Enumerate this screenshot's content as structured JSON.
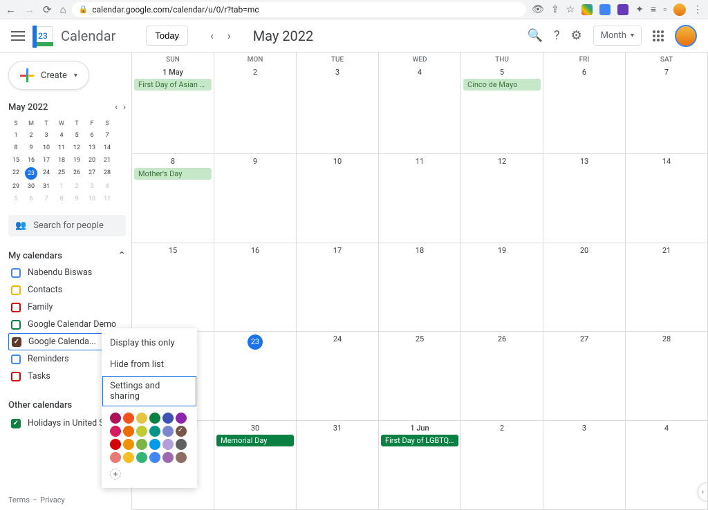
{
  "browser": {
    "url": "calendar.google.com/calendar/u/0/r?tab=mc"
  },
  "header": {
    "app_name": "Calendar",
    "logo_day": "23",
    "today_label": "Today",
    "current_period": "May 2022",
    "view_label": "Month"
  },
  "create": {
    "label": "Create"
  },
  "mini": {
    "month": "May 2022",
    "dow": [
      "S",
      "M",
      "T",
      "W",
      "T",
      "F",
      "S"
    ],
    "weeks": [
      [
        {
          "n": "1"
        },
        {
          "n": "2"
        },
        {
          "n": "3"
        },
        {
          "n": "4"
        },
        {
          "n": "5"
        },
        {
          "n": "6"
        },
        {
          "n": "7"
        }
      ],
      [
        {
          "n": "8"
        },
        {
          "n": "9"
        },
        {
          "n": "10"
        },
        {
          "n": "11"
        },
        {
          "n": "12"
        },
        {
          "n": "13"
        },
        {
          "n": "14"
        }
      ],
      [
        {
          "n": "15"
        },
        {
          "n": "16"
        },
        {
          "n": "17"
        },
        {
          "n": "18"
        },
        {
          "n": "19"
        },
        {
          "n": "20"
        },
        {
          "n": "21"
        }
      ],
      [
        {
          "n": "22"
        },
        {
          "n": "23",
          "today": true
        },
        {
          "n": "24"
        },
        {
          "n": "25"
        },
        {
          "n": "26"
        },
        {
          "n": "27"
        },
        {
          "n": "28"
        }
      ],
      [
        {
          "n": "29"
        },
        {
          "n": "30"
        },
        {
          "n": "31"
        },
        {
          "n": "1",
          "other": true
        },
        {
          "n": "2",
          "other": true
        },
        {
          "n": "3",
          "other": true
        },
        {
          "n": "4",
          "other": true
        }
      ],
      [
        {
          "n": "5",
          "other": true
        },
        {
          "n": "6",
          "other": true
        },
        {
          "n": "7",
          "other": true
        },
        {
          "n": "8",
          "other": true
        },
        {
          "n": "9",
          "other": true
        },
        {
          "n": "10",
          "other": true
        },
        {
          "n": "11",
          "other": true
        }
      ]
    ]
  },
  "search": {
    "placeholder": "Search for people"
  },
  "my_calendars": {
    "title": "My calendars",
    "items": [
      {
        "label": "Nabendu Biswas",
        "color": "#4285f4",
        "checked": false
      },
      {
        "label": "Contacts",
        "color": "#f4b400",
        "checked": false
      },
      {
        "label": "Family",
        "color": "#d50000",
        "checked": false
      },
      {
        "label": "Google Calendar Demo",
        "color": "#0b8043",
        "checked": false
      },
      {
        "label": "Google Calenda...",
        "color": "#5f3a29",
        "checked": true,
        "focused": true,
        "close": true
      },
      {
        "label": "Reminders",
        "color": "#4285f4",
        "checked": false
      },
      {
        "label": "Tasks",
        "color": "#d50000",
        "checked": false
      }
    ]
  },
  "other_calendars": {
    "title": "Other calendars",
    "items": [
      {
        "label": "Holidays in United States",
        "color": "#0b8043",
        "checked": true
      }
    ]
  },
  "footer": {
    "terms": "Terms",
    "privacy": "Privacy",
    "sep": "–"
  },
  "grid": {
    "dow": [
      "SUN",
      "MON",
      "TUE",
      "WED",
      "THU",
      "FRI",
      "SAT"
    ],
    "weeks": [
      [
        {
          "n": "1 May",
          "first": true,
          "events": [
            {
              "t": "First Day of Asian Pacific",
              "cls": "holiday"
            }
          ]
        },
        {
          "n": "2"
        },
        {
          "n": "3"
        },
        {
          "n": "4"
        },
        {
          "n": "5",
          "events": [
            {
              "t": "Cinco de Mayo",
              "cls": "holiday"
            }
          ]
        },
        {
          "n": "6"
        },
        {
          "n": "7"
        }
      ],
      [
        {
          "n": "8",
          "events": [
            {
              "t": "Mother's Day",
              "cls": "holiday"
            }
          ]
        },
        {
          "n": "9"
        },
        {
          "n": "10"
        },
        {
          "n": "11"
        },
        {
          "n": "12"
        },
        {
          "n": "13"
        },
        {
          "n": "14"
        }
      ],
      [
        {
          "n": "15"
        },
        {
          "n": "16"
        },
        {
          "n": "17"
        },
        {
          "n": "18"
        },
        {
          "n": "19"
        },
        {
          "n": "20"
        },
        {
          "n": "21"
        }
      ],
      [
        {
          "n": "22"
        },
        {
          "n": "23",
          "today": true
        },
        {
          "n": "24"
        },
        {
          "n": "25"
        },
        {
          "n": "26"
        },
        {
          "n": "27"
        },
        {
          "n": "28"
        }
      ],
      [
        {
          "n": "29"
        },
        {
          "n": "30",
          "events": [
            {
              "t": "Memorial Day",
              "cls": "solid"
            }
          ]
        },
        {
          "n": "31"
        },
        {
          "n": "1 Jun",
          "first": true,
          "events": [
            {
              "t": "First Day of LGBTQ+ Pride",
              "cls": "solid"
            }
          ]
        },
        {
          "n": "2"
        },
        {
          "n": "3"
        },
        {
          "n": "4"
        }
      ]
    ]
  },
  "menu": {
    "items": [
      "Display this only",
      "Hide from list",
      "Settings and sharing"
    ],
    "highlighted": 2,
    "colors": [
      "#ad1457",
      "#f4511e",
      "#e4c441",
      "#0b8043",
      "#3f51b5",
      "#8e24aa",
      "#d81b60",
      "#ef6c00",
      "#c0ca33",
      "#009688",
      "#7986cb",
      "#795548",
      "#d50000",
      "#f09300",
      "#7cb342",
      "#039be5",
      "#b39ddb",
      "#616161",
      "#e67c73",
      "#f6bf26",
      "#33b679",
      "#4285f4",
      "#9e69af",
      "#8d6e63"
    ],
    "selected_color": 11
  }
}
